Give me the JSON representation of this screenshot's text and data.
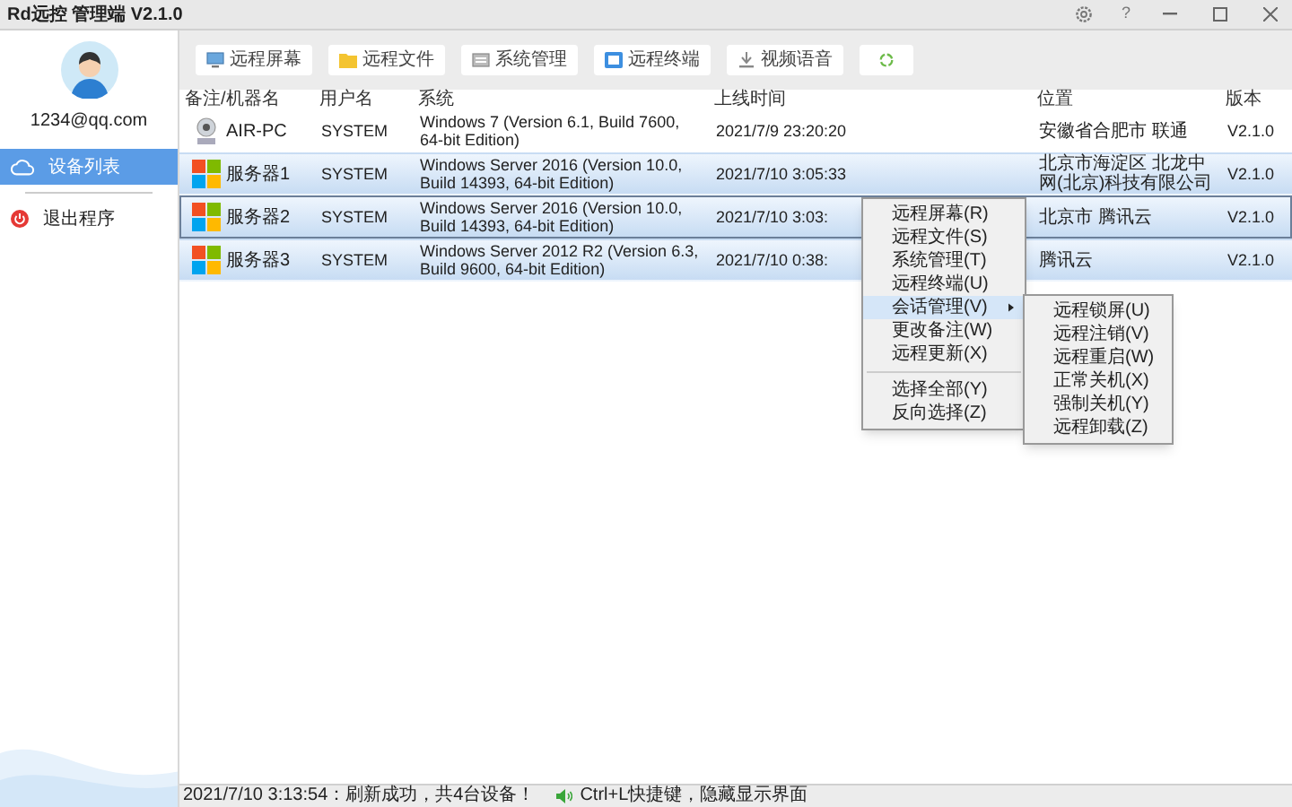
{
  "window": {
    "title": "Rd远控 管理端 V2.1.0",
    "help": "?"
  },
  "sidebar": {
    "email": "1234@qq.com",
    "items": [
      {
        "label": "设备列表",
        "kind": "cloud",
        "selected": true
      },
      {
        "label": "退出程序",
        "kind": "power",
        "selected": false
      }
    ]
  },
  "toolbar": [
    {
      "label": "远程屏幕",
      "kind": "monitor"
    },
    {
      "label": "远程文件",
      "kind": "folder"
    },
    {
      "label": "系统管理",
      "kind": "system"
    },
    {
      "label": "远程终端",
      "kind": "terminal"
    },
    {
      "label": "视频语音",
      "kind": "video"
    },
    {
      "kind": "refresh"
    }
  ],
  "table": {
    "columns": [
      "备注/机器名",
      "用户名",
      "系统",
      "上线时间",
      "位置",
      "版本"
    ],
    "rows": [
      {
        "name": "AIR-PC",
        "kind": "pc",
        "user": "SYSTEM",
        "system": "Windows 7 (Version 6.1, Build 7600, 64-bit Edition)",
        "online": "2021/7/9 23:20:20",
        "location": "安徽省合肥市 联通",
        "version": "V2.1.0",
        "selected": false,
        "focused": false
      },
      {
        "name": "服务器1",
        "kind": "windows",
        "user": "SYSTEM",
        "system": "Windows Server 2016 (Version 10.0, Build 14393, 64-bit Edition)",
        "online": "2021/7/10 3:05:33",
        "location": "北京市海淀区 北龙中网(北京)科技有限公司",
        "version": "V2.1.0",
        "selected": true,
        "focused": false
      },
      {
        "name": "服务器2",
        "kind": "windows",
        "user": "SYSTEM",
        "system": "Windows Server 2016 (Version 10.0, Build 14393, 64-bit Edition)",
        "online": "2021/7/10 3:03:",
        "location": "北京市 腾讯云",
        "version": "V2.1.0",
        "selected": true,
        "focused": true
      },
      {
        "name": "服务器3",
        "kind": "windows",
        "user": "SYSTEM",
        "system": "Windows Server 2012 R2 (Version 6.3, Build 9600, 64-bit Edition)",
        "online": "2021/7/10 0:38:",
        "location": "腾讯云",
        "version": "V2.1.0",
        "selected": true,
        "focused": false
      }
    ]
  },
  "context_menu": {
    "items": [
      {
        "kind": "item",
        "label": "远程屏幕(R)",
        "selected": false
      },
      {
        "kind": "item",
        "label": "远程文件(S)",
        "selected": false
      },
      {
        "kind": "item",
        "label": "系统管理(T)",
        "selected": false
      },
      {
        "kind": "item",
        "label": "远程终端(U)",
        "selected": false
      },
      {
        "kind": "submenu",
        "label": "会话管理(V)",
        "selected": true
      },
      {
        "kind": "item",
        "label": "更改备注(W)",
        "selected": false
      },
      {
        "kind": "item",
        "label": "远程更新(X)",
        "selected": false
      },
      {
        "kind": "separator"
      },
      {
        "kind": "item",
        "label": "选择全部(Y)",
        "selected": false
      },
      {
        "kind": "item",
        "label": "反向选择(Z)",
        "selected": false
      }
    ],
    "submenu": [
      {
        "label": "远程锁屏(U)",
        "selected": false
      },
      {
        "label": "远程注销(V)",
        "selected": false
      },
      {
        "label": "远程重启(W)",
        "selected": false
      },
      {
        "label": "正常关机(X)",
        "selected": false
      },
      {
        "label": "强制关机(Y)",
        "selected": false
      },
      {
        "label": "远程卸载(Z)",
        "selected": false
      }
    ]
  },
  "status_bar": {
    "message": "2021/7/10 3:13:54：刷新成功，共4台设备！",
    "hint": "Ctrl+L快捷键，隐藏显示界面"
  }
}
